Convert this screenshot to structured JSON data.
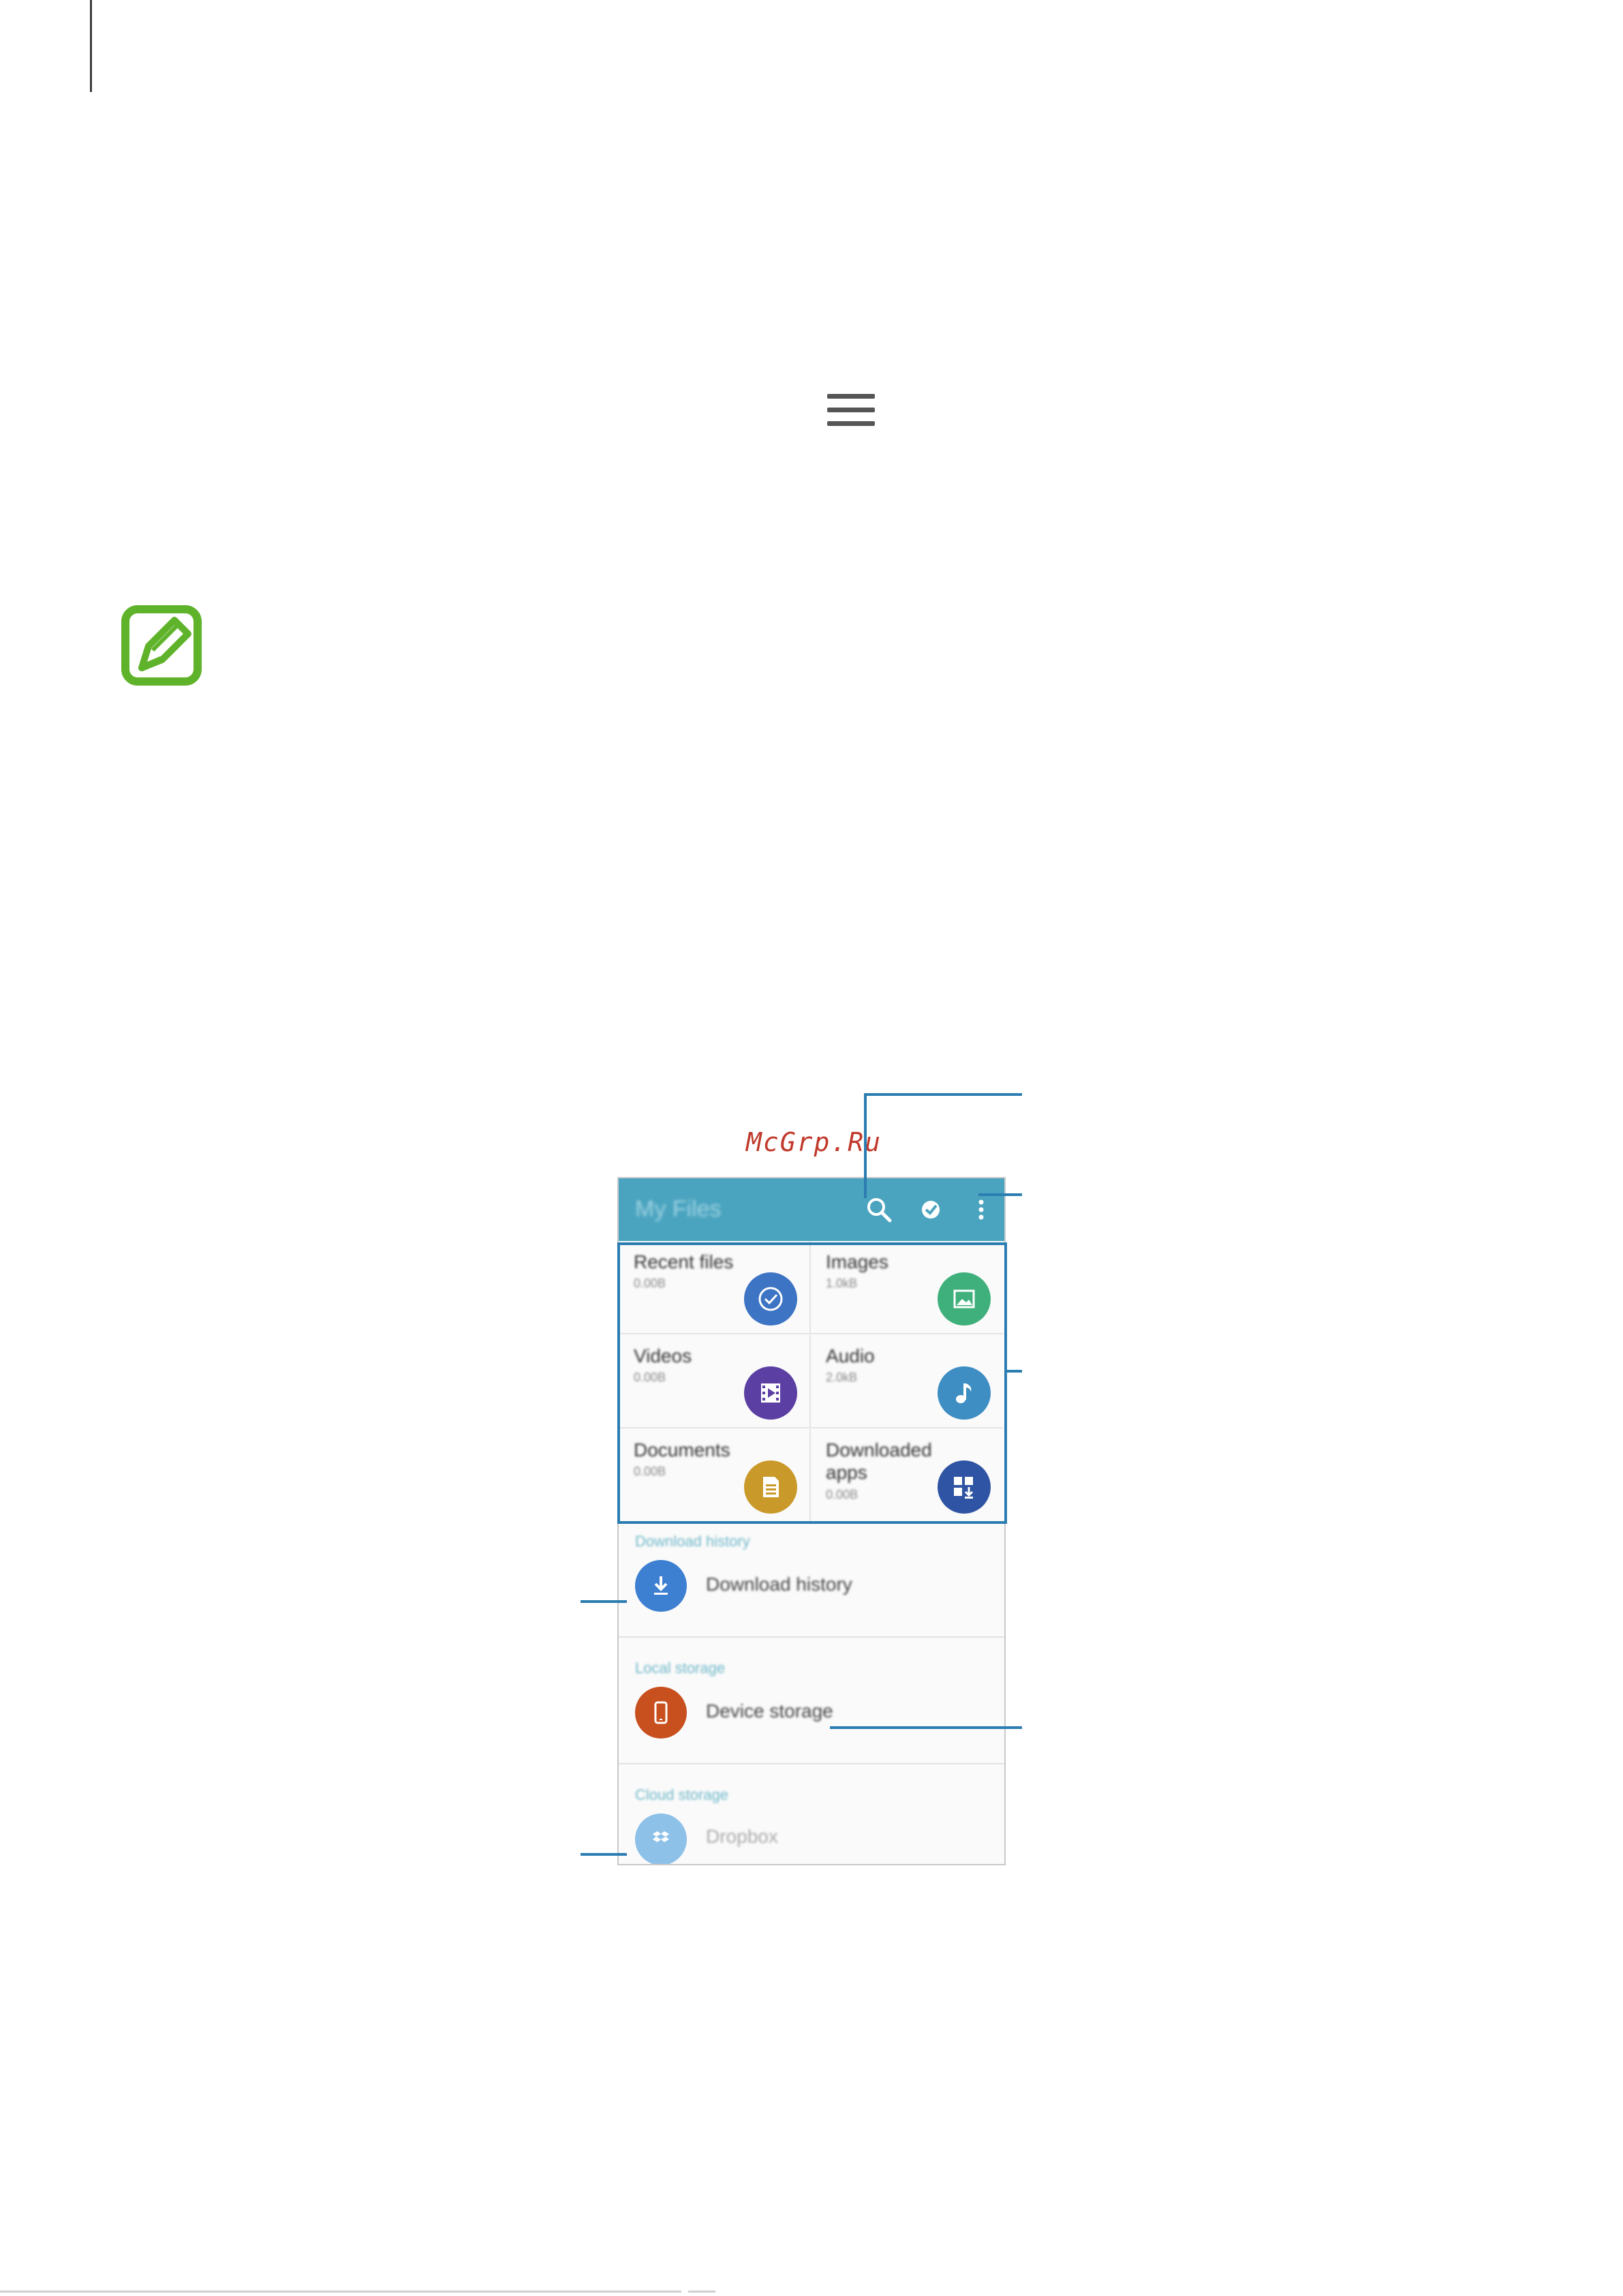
{
  "screen": {
    "app_title": "My Files",
    "categories": [
      {
        "label": "Recent files",
        "size": "0.00B",
        "icon": "clock-check-icon",
        "color": "#3d74c4"
      },
      {
        "label": "Images",
        "size": "1.0kB",
        "icon": "image-icon",
        "color": "#3fb07c"
      },
      {
        "label": "Videos",
        "size": "0.00B",
        "icon": "film-icon",
        "color": "#5b3fa3"
      },
      {
        "label": "Audio",
        "size": "2.0kB",
        "icon": "music-note-icon",
        "color": "#3e8ec4"
      },
      {
        "label": "Documents",
        "size": "0.00B",
        "icon": "document-icon",
        "color": "#c99a2a"
      },
      {
        "label": "Downloaded apps",
        "size": "0.00B",
        "icon": "apps-download-icon",
        "color": "#2f54a3"
      }
    ],
    "download_history": {
      "header": "Download history",
      "label": "Download history",
      "color": "#3d7fd1"
    },
    "local_storage": {
      "header": "Local storage",
      "label": "Device storage",
      "color": "#c8501e"
    },
    "cloud_storage": {
      "header": "Cloud storage",
      "label": "Dropbox",
      "color": "#8ec1e8"
    }
  },
  "watermark": "McGrp.Ru",
  "colors": {
    "callout": "#2b7db1",
    "note_icon": "#5fb32a",
    "appbar": "#4aa4bf"
  }
}
